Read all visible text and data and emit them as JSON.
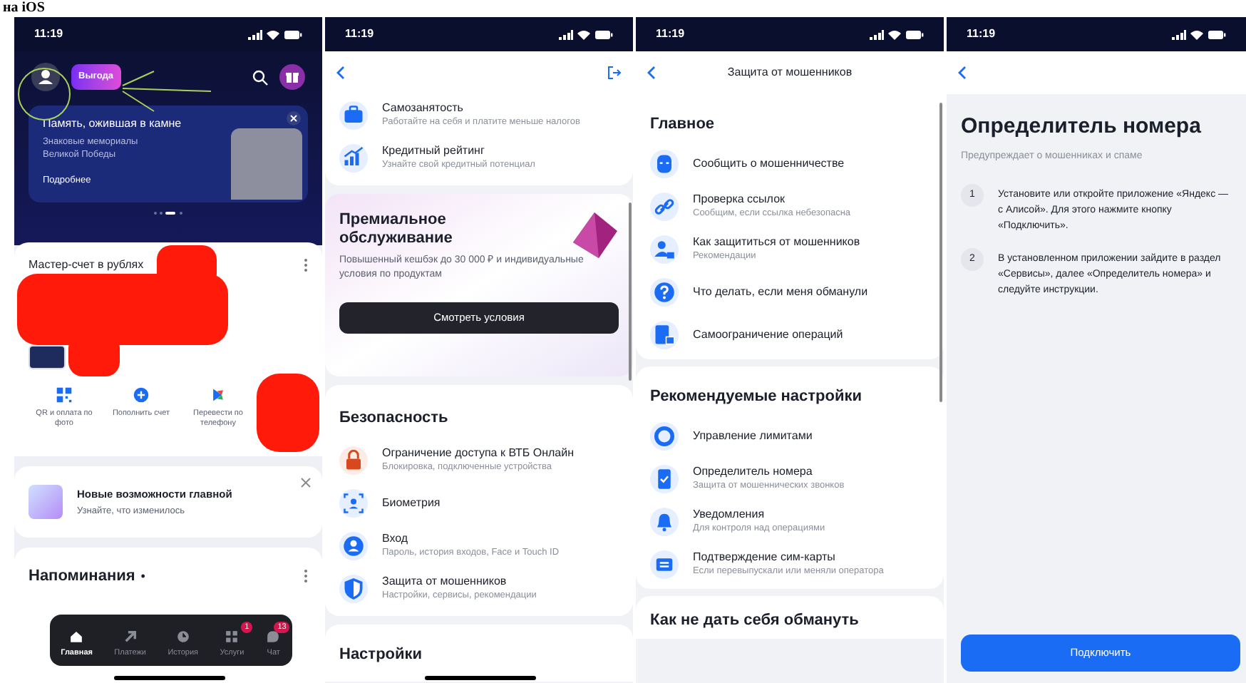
{
  "caption": "на iOS",
  "home": {
    "status_time": "11:19",
    "promo_chip": "Выгода",
    "banner": {
      "title": "Память, ожившая в камне",
      "subtitle": "Знаковые мемориалы Великой Победы",
      "link": "Подробнее"
    },
    "account": {
      "title": "Мастер-счет в рублях"
    },
    "actions": [
      "QR и оплата по фото",
      "Пополнить счет",
      "Перевести по телефону"
    ],
    "news": {
      "title": "Новые возможности главной",
      "subtitle": "Узнайте, что изменилось"
    },
    "reminders": {
      "title": "Напоминания",
      "marker": "•"
    },
    "tabs": [
      {
        "label": "Главная",
        "selected": true
      },
      {
        "label": "Платежи",
        "selected": false
      },
      {
        "label": "История",
        "selected": false
      },
      {
        "label": "Услуги",
        "selected": false,
        "badge": "1"
      },
      {
        "label": "Чат",
        "selected": false,
        "badge": "13"
      }
    ]
  },
  "services": {
    "status_time": "11:19",
    "items": [
      {
        "title": "Самозанятость",
        "subtitle": "Работайте на себя и платите меньше налогов"
      },
      {
        "title": "Кредитный рейтинг",
        "subtitle": "Узнайте свой кредитный потенциал"
      }
    ],
    "premium": {
      "title": "Премиальное обслуживание",
      "text": "Повышенный кешбэк до 30 000 ₽ и индивидуальные условия по продуктам",
      "button": "Смотреть условия"
    },
    "security": {
      "heading": "Безопасность",
      "items": [
        {
          "title": "Ограничение доступа к ВТБ Онлайн",
          "subtitle": "Блокировка, подключенные устройства"
        },
        {
          "title": "Биометрия"
        },
        {
          "title": "Вход",
          "subtitle": "Пароль, история входов, Face и Touch ID"
        },
        {
          "title": "Защита от мошенников",
          "subtitle": "Настройки, сервисы, рекомендации"
        }
      ]
    },
    "next_heading": "Настройки"
  },
  "fraud": {
    "status_time": "11:19",
    "title": "Защита от мошенников",
    "sections": [
      {
        "heading": "Главное",
        "items": [
          {
            "title": "Сообщить о мошенничестве"
          },
          {
            "title": "Проверка ссылок",
            "subtitle": "Сообщим, если ссылка небезопасна"
          },
          {
            "title": "Как защититься от мошенников",
            "subtitle": "Рекомендации"
          },
          {
            "title": "Что делать, если меня обманули"
          },
          {
            "title": "Самоограничение операций"
          }
        ]
      },
      {
        "heading": "Рекомендуемые настройки",
        "items": [
          {
            "title": "Управление лимитами"
          },
          {
            "title": "Определитель номера",
            "subtitle": "Защита от мошеннических звонков"
          },
          {
            "title": "Уведомления",
            "subtitle": "Для контроля над операциями"
          },
          {
            "title": "Подтверждение сим-карты",
            "subtitle": "Если перевыпускали или меняли оператора"
          }
        ]
      }
    ],
    "next_heading": "Как не дать себя обмануть"
  },
  "caller_id": {
    "status_time": "11:19",
    "title": "Определитель номера",
    "subtitle": "Предупреждает о мошенниках и спаме",
    "steps": [
      {
        "number": "1",
        "text": "Установите или откройте приложение «Яндекс — с Алисой». Для этого нажмите кнопку «Подключить»."
      },
      {
        "number": "2",
        "text": "В установленном приложении зайдите в раздел «Сервисы», далее «Определитель номера» и следуйте инструкции."
      }
    ],
    "button": "Подключить"
  }
}
